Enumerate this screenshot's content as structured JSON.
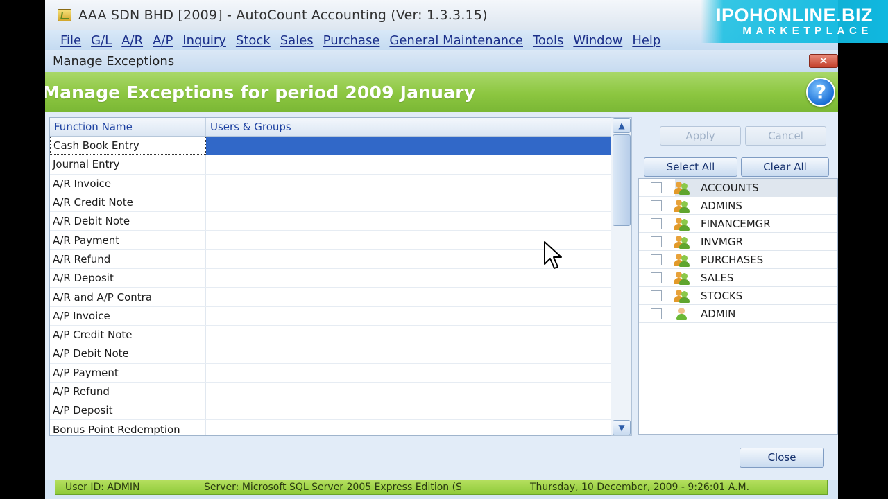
{
  "app": {
    "title": "AAA SDN BHD [2009] - AutoCount Accounting (Ver: 1.3.3.15)",
    "menu": [
      "File",
      "G/L",
      "A/R",
      "A/P",
      "Inquiry",
      "Stock",
      "Sales",
      "Purchase",
      "General Maintenance",
      "Tools",
      "Window",
      "Help"
    ]
  },
  "watermark": {
    "line1": "IPOHONLINE.BIZ",
    "line2": "MARKETPLACE"
  },
  "dialog": {
    "title": "Manage Exceptions",
    "close_glyph": "✕",
    "banner": "Manage Exceptions for period 2009 January",
    "help_glyph": "?"
  },
  "grid": {
    "columns": [
      "Function Name",
      "Users & Groups"
    ],
    "rows": [
      "Cash Book Entry",
      "Journal Entry",
      "A/R Invoice",
      "A/R Credit Note",
      "A/R Debit Note",
      "A/R Payment",
      "A/R Refund",
      "A/R Deposit",
      "A/R and A/P Contra",
      "A/P Invoice",
      "A/P Credit Note",
      "A/P Debit Note",
      "A/P Payment",
      "A/P Refund",
      "A/P Deposit",
      "Bonus Point Redemption"
    ],
    "selected_index": 0
  },
  "panel": {
    "apply_label": "Apply",
    "cancel_label": "Cancel",
    "select_all_label": "Select All",
    "clear_all_label": "Clear All",
    "groups": [
      {
        "name": "ACCOUNTS",
        "icon": "user-group-icon"
      },
      {
        "name": "ADMINS",
        "icon": "user-group-icon"
      },
      {
        "name": "FINANCEMGR",
        "icon": "user-group-icon"
      },
      {
        "name": "INVMGR",
        "icon": "user-group-icon"
      },
      {
        "name": "PURCHASES",
        "icon": "user-group-icon"
      },
      {
        "name": "SALES",
        "icon": "user-group-icon"
      },
      {
        "name": "STOCKS",
        "icon": "user-group-icon"
      },
      {
        "name": "ADMIN",
        "icon": "user-icon"
      }
    ]
  },
  "footer": {
    "close_label": "Close"
  },
  "status": {
    "user": "User ID: ADMIN",
    "server": "Server: Microsoft SQL Server 2005 Express Edition (S",
    "date": "Thursday, 10 December, 2009 - 9:26:01 A.M."
  },
  "colors": {
    "banner_green": "#8cc640",
    "selection_blue": "#3168c8",
    "menu_text": "#1b2f8a"
  }
}
